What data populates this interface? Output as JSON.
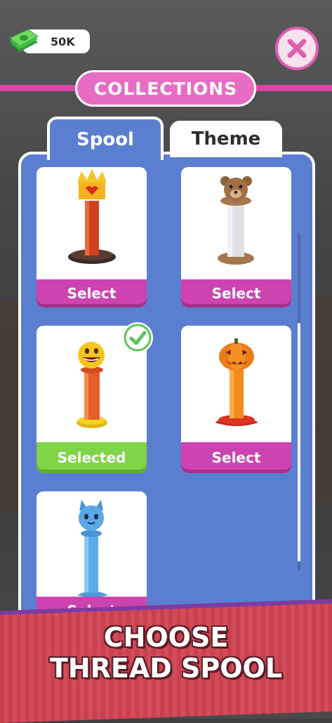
{
  "currency": {
    "amount": "50K",
    "icon": "cash-stack-icon"
  },
  "header": {
    "title": "COLLECTIONS"
  },
  "tabs": [
    {
      "label": "Spool",
      "active": true
    },
    {
      "label": "Theme",
      "active": false
    }
  ],
  "items": [
    {
      "name": "crown-spool",
      "button": "Select",
      "selected": false
    },
    {
      "name": "teddy-bear-spool",
      "button": "Select",
      "selected": false
    },
    {
      "name": "emoji-spool",
      "button": "Selected",
      "selected": true
    },
    {
      "name": "pumpkin-spool",
      "button": "Select",
      "selected": false
    },
    {
      "name": "blue-cat-spool",
      "button": "Select",
      "selected": false
    }
  ],
  "banner": {
    "line1": "CHOOSE",
    "line2": "THREAD SPOOL"
  },
  "colors": {
    "accent": "#cd44b1",
    "panel": "#5b7fd0",
    "selected": "#7fd447",
    "banner": "#c9404f"
  }
}
